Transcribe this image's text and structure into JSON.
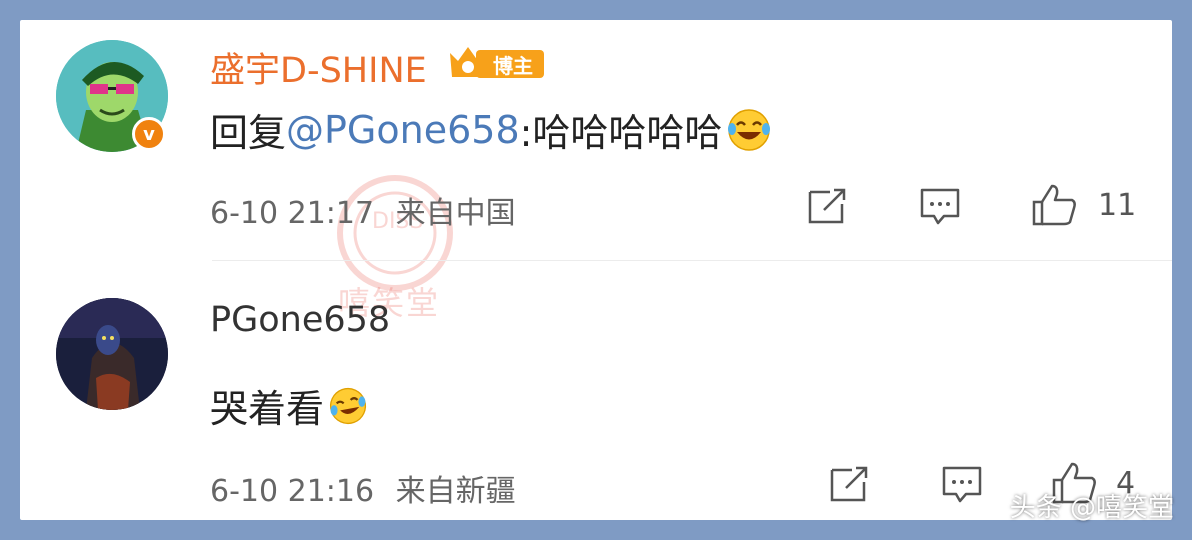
{
  "comments": [
    {
      "author": "盛宇D-SHINE",
      "author_color": "#eb6f2d",
      "badge": "博主",
      "verified_mark": "v",
      "reply_prefix": "回复",
      "mention": "@PGone658",
      "text": ":哈哈哈哈哈",
      "emoji": "laughing-tears-emoji",
      "time": "6-10 21:17",
      "location": "来自中国",
      "likes": "11"
    },
    {
      "author": "PGone658",
      "text": "哭着看",
      "emoji": "crying-laughing-emoji",
      "time": "6-10 21:16",
      "location": "来自新疆",
      "likes": "4"
    }
  ],
  "watermark": "嘻笑堂",
  "credit": "头条 @嘻笑堂",
  "icons": [
    "share-icon",
    "comment-icon",
    "like-icon"
  ]
}
